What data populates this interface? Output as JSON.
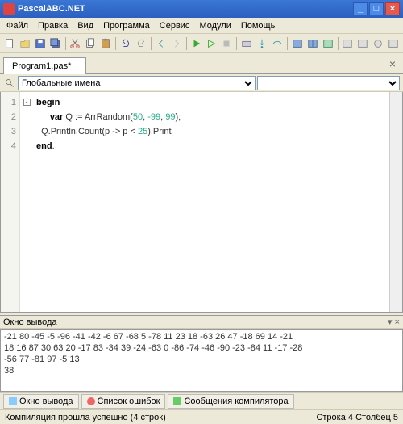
{
  "title": "PascalABC.NET",
  "menu": [
    "Файл",
    "Правка",
    "Вид",
    "Программа",
    "Сервис",
    "Модули",
    "Помощь"
  ],
  "tab": "Program1.pas*",
  "dropdown": "Глобальные имена",
  "code": {
    "l1_kw": "begin",
    "l2_kw": "var",
    "l2a": " Q := ArrRandom(",
    "l2n1": "50",
    "l2s1": ", ",
    "l2n2": "-99",
    "l2s2": ", ",
    "l2n3": "99",
    "l2b": ");",
    "l3a": "  Q.Println.Count(p -> p < ",
    "l3n": "25",
    "l3b": ").Print",
    "l4_kw": "end",
    "l4b": "."
  },
  "gutter": [
    "1",
    "2",
    "3",
    "4"
  ],
  "output_title": "Окно вывода",
  "output_lines": [
    "-21 80 -45 -5 -96 -41 -42 -6 67 -68 5 -78 11 23 18 -63 26 47 -18 69 14 -21",
    "18 16 87 30 63 20 -17 83 -34 39 -24 -63 0 -86 -74 -46 -90 -23 -84 11 -17 -28",
    "-56 77 -81 97 -5 13",
    "38"
  ],
  "bottom_tabs": [
    "Окно вывода",
    "Список ошибок",
    "Сообщения компилятора"
  ],
  "status_left": "Компиляция прошла успешно (4 строк)",
  "status_right": "Строка 4 Столбец 5"
}
